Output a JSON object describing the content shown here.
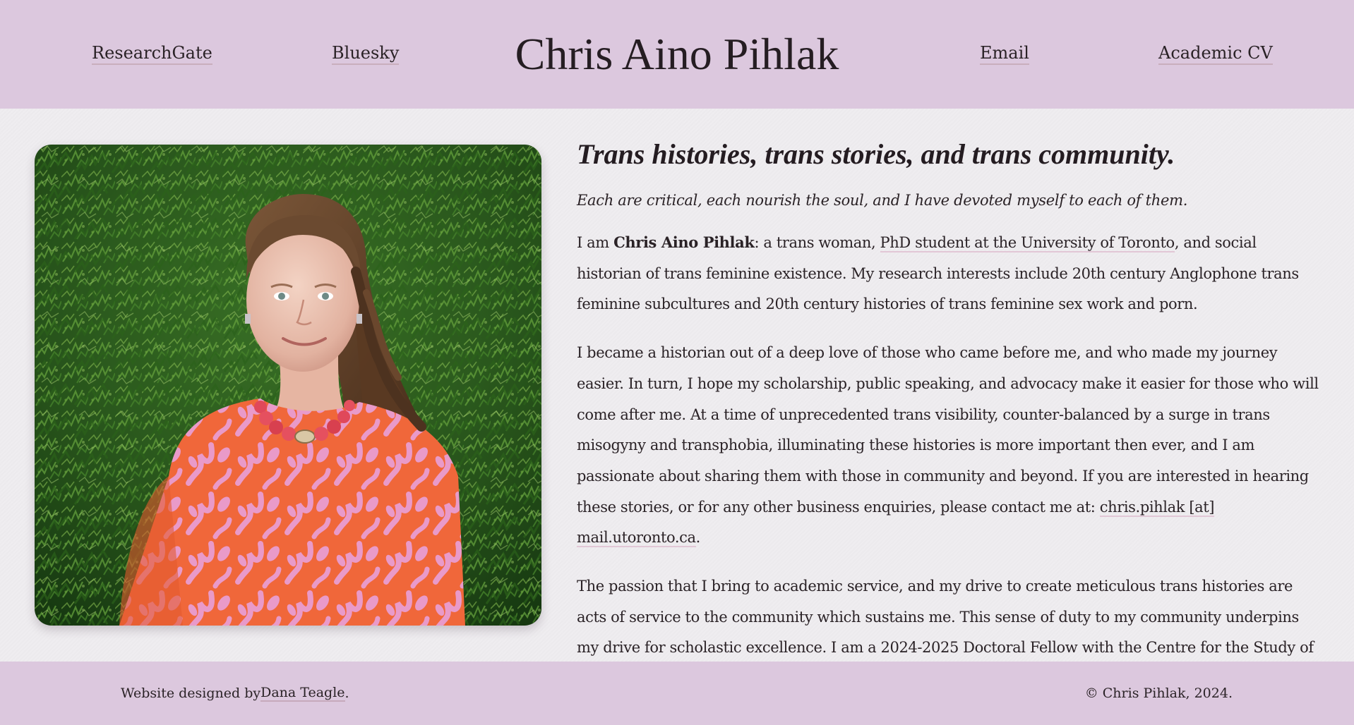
{
  "colors": {
    "header_bg": "#dcc8de",
    "page_bg": "#efedf0",
    "text": "#2a2226",
    "link_underline": "#e2c7d6"
  },
  "header": {
    "title": "Chris Aino Pihlak",
    "nav": {
      "researchgate": "ResearchGate",
      "bluesky": "Bluesky",
      "email": "Email",
      "cv": "Academic CV"
    }
  },
  "main": {
    "photo_alt": "Portrait of Chris Aino Pihlak smiling in front of a green hedge, wearing an orange and pink floral top and a red beaded necklace",
    "headline": "Trans histories, trans stories, and trans community.",
    "tagline": "Each are critical, each nourish the soul, and I have devoted myself to each of them.",
    "p1": {
      "before": "I am ",
      "name": "Chris Aino Pihlak",
      "middle": ": a trans woman, ",
      "link": "PhD student at the University of Toronto",
      "after": ", and social historian of trans feminine existence. My research interests include 20th century Anglophone trans feminine subcultures and 20th century histories of trans feminine sex work and porn."
    },
    "p2": {
      "text": "I became a historian out of a deep love of those who came before me, and who made my journey easier. In turn, I hope my scholarship, public speaking, and advocacy make it easier for those who will come after me. At a time of unprecedented trans visibility, counter-balanced by a surge in trans misogyny and transphobia, illuminating these histories is more important then ever, and I am passionate about sharing them with those in community and beyond. If you are interested in hearing these stories, or for any other business enquiries, please contact me at: ",
      "email_link": "chris.pihlak [at] mail.utoronto.ca",
      "after": "."
    },
    "p3": {
      "text": "The passion that I bring to academic service, and my drive to create meticulous trans histories are acts of service to the community which sustains me. This sense of duty to my community underpins my drive for scholastic excellence. I am a 2024-2025 Doctoral Fellow with the Centre for the Study of the United States and the Jackman Humanities Institute, as well as being an Ontario Graduate Scholarship recipient for this academic year."
    }
  },
  "footer": {
    "credit_prefix": "Website designed by ",
    "credit_link": "Dana Teagle",
    "credit_suffix": ".",
    "copyright": "© Chris Pihlak, 2024."
  }
}
